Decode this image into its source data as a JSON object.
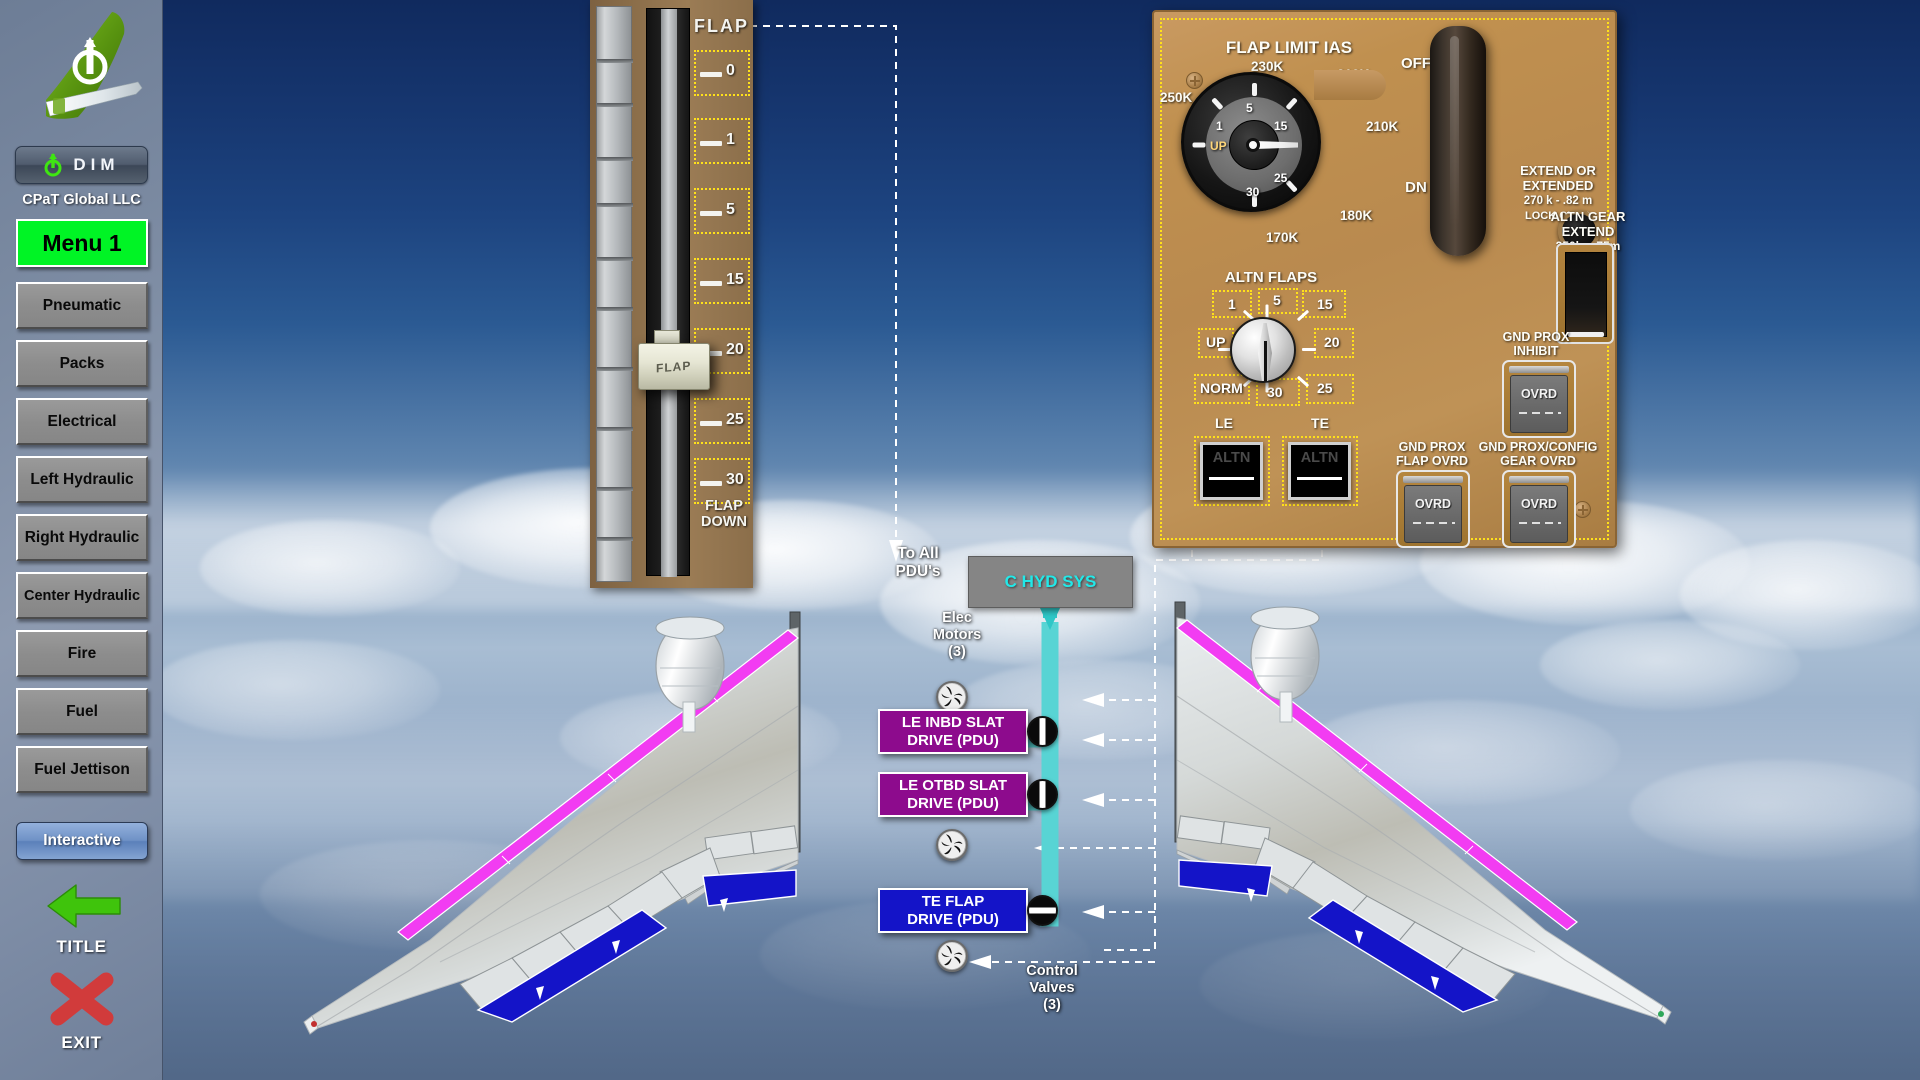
{
  "brand": {
    "company": "CPaT Global LLC",
    "dim_label": "DIM",
    "logo_icon": "airline-tail-logo",
    "power_icon": "power-symbol-icon"
  },
  "sidebar": {
    "menu_header": "Menu 1",
    "items": [
      {
        "label": "Pneumatic"
      },
      {
        "label": "Packs"
      },
      {
        "label": "Electrical"
      },
      {
        "label": "Left Hydraulic"
      },
      {
        "label": "Right Hydraulic"
      },
      {
        "label": "Center Hydraulic"
      },
      {
        "label": "Fire"
      },
      {
        "label": "Fuel"
      },
      {
        "label": "Fuel Jettison"
      }
    ],
    "interactive_label": "Interactive",
    "title_button": {
      "label": "TITLE",
      "icon": "back-arrow-icon",
      "color": "#3fc40c"
    },
    "exit_button": {
      "label": "EXIT",
      "icon": "close-x-icon",
      "color": "#d13b3b"
    }
  },
  "flap_quadrant": {
    "title": "FLAP",
    "handle_label": "FLAP",
    "flap_down_label": "FLAP\nDOWN",
    "flap_down_line1": "FLAP",
    "flap_down_line2": "DOWN",
    "detents": [
      "0",
      "1",
      "5",
      "15",
      "20",
      "25",
      "30"
    ],
    "selected_detent": "20"
  },
  "overhead_panel": {
    "flap_limit_title": "FLAP LIMIT IAS",
    "limit_speeds": {
      "top": "230K",
      "upper_right": "210K",
      "right": "210K",
      "left": "250K",
      "lower_right": "180K",
      "bottom": "170K"
    },
    "dial_positions": [
      "UP",
      "1",
      "5",
      "15",
      "25",
      "30"
    ],
    "dial_selected": "15",
    "lever_off": "OFF",
    "lever_dn": "DN",
    "extend_note": {
      "l1": "EXTEND OR",
      "l2": "EXTENDED",
      "l3": "270 k - .82 m",
      "l4": "LOCK OVRD"
    },
    "altn_flaps_title": "ALTN FLAPS",
    "altn_positions": [
      "UP",
      "NORM",
      "1",
      "5",
      "15",
      "20",
      "25",
      "30"
    ],
    "altn_le_label": "LE",
    "altn_te_label": "TE",
    "annunciators": [
      {
        "label": "ALTN",
        "side": "LE"
      },
      {
        "label": "ALTN",
        "side": "TE"
      }
    ],
    "altn_gear_extend": {
      "l1": "ALTN GEAR",
      "l2": "EXTEND",
      "l3": "250k - .75m"
    },
    "gnd_prox_inhibit": {
      "l1": "GND PROX",
      "l2": "INHIBIT",
      "switch": "OVRD"
    },
    "gnd_prox_flap_ovrd": {
      "l1": "GND PROX",
      "l2": "FLAP OVRD",
      "switch": "OVRD"
    },
    "gnd_prox_config_gear_ovrd": {
      "l1": "GND PROX/CONFIG",
      "l2": "GEAR OVRD",
      "switch": "OVRD"
    }
  },
  "schematic": {
    "to_all_pdus": {
      "l1": "To All",
      "l2": "PDU's"
    },
    "elec_motors": {
      "l1": "Elec",
      "l2": "Motors",
      "l3": "(3)"
    },
    "control_valves": {
      "l1": "Control",
      "l2": "Valves",
      "l3": "(3)"
    },
    "c_hyd_sys": "C HYD SYS",
    "pdus": [
      {
        "l1": "LE INBD SLAT",
        "l2": "DRIVE (PDU)",
        "color": "#8d0b8d"
      },
      {
        "l1": "LE OTBD SLAT",
        "l2": "DRIVE (PDU)",
        "color": "#8d0b8d"
      },
      {
        "l1": "TE FLAP",
        "l2": "DRIVE (PDU)",
        "color": "#1414c8"
      }
    ],
    "hyd_color": "#58d4d4"
  },
  "wings": {
    "slat_color": "#f23cf2",
    "flap_color": "#1414c8",
    "left_label": "left-wing",
    "right_label": "right-wing"
  }
}
